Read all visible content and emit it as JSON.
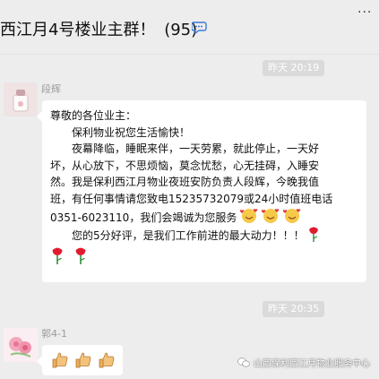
{
  "header": {
    "title": "西江月4号楼业主群！",
    "member_count": "(95)",
    "muted_icon": "speech-bubble-icon",
    "menu_icon": "more-dots-icon"
  },
  "messages": [
    {
      "time": "昨天 20:19",
      "sender": "段辉",
      "lines": [
        "尊敬的各位业主：",
        "保利物业祝您生活愉快！",
        "夜幕降临，睡眠来伴，一天劳累，就此停止，一天好",
        "坏，从心放下，不思烦恼，莫念忧愁，心无挂碍，入睡安",
        "然。我是保利西江月物业夜班安防负责人段辉，今晚我值",
        "班，有任何事情请您致电15235732079或24小时值班电话",
        "0351-6023110，我们会竭诚为您服务",
        "您的5分好评，是我们工作前进的最大动力！！！"
      ]
    },
    {
      "time": "昨天 20:35",
      "sender": "郭4-1"
    }
  ],
  "watermark": "山西保利西江月物业服务中心",
  "colors": {
    "background": "#ededed",
    "bubble": "#ffffff",
    "time_chip": "#dadada",
    "sender": "#9a9a9a"
  }
}
